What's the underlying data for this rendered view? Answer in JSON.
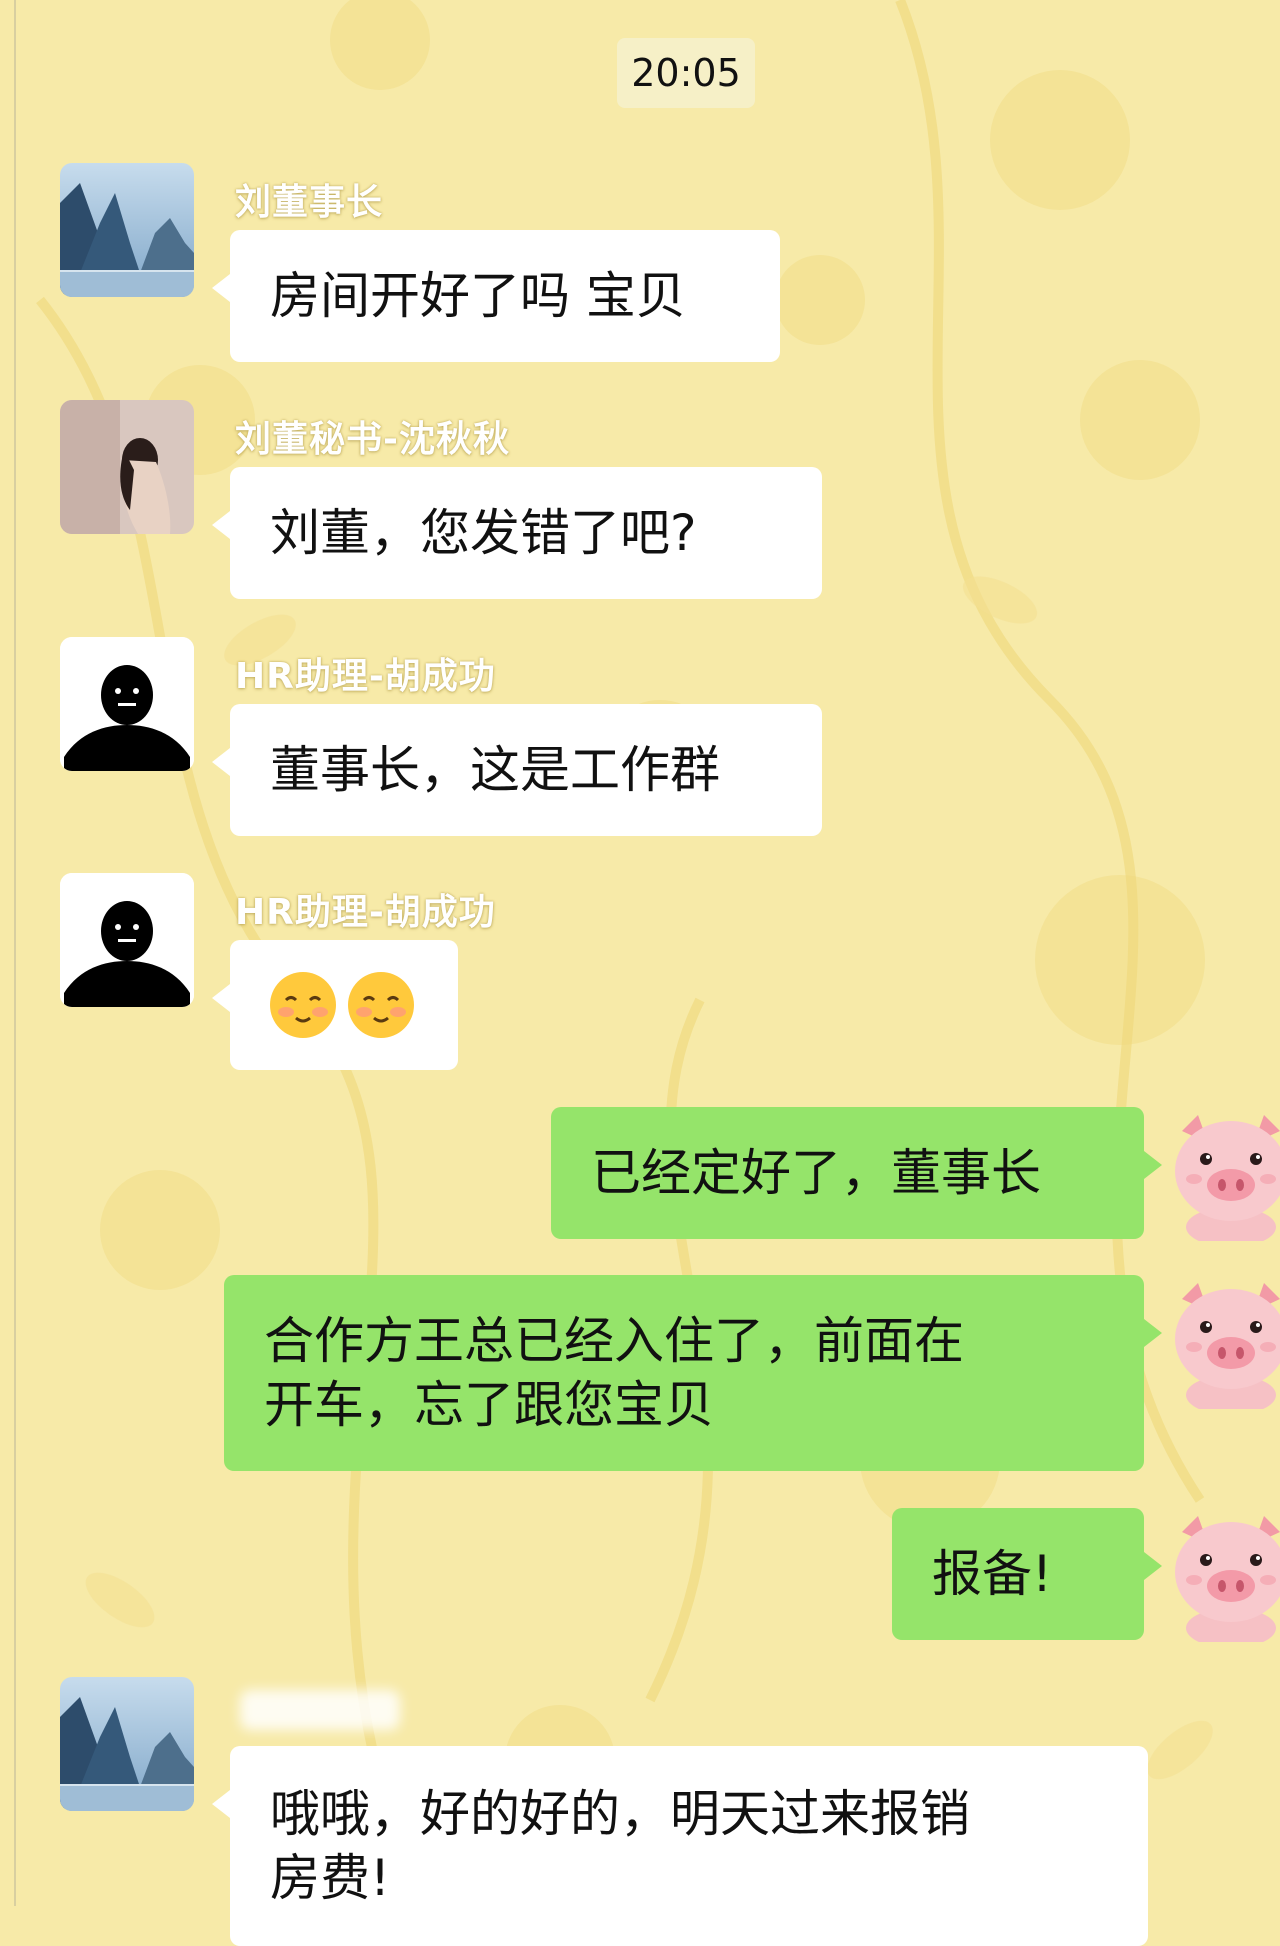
{
  "header": {
    "time": "20:05"
  },
  "messages": [
    {
      "sender": "刘董事长",
      "text": "房间开好了吗 宝贝",
      "direction": "in",
      "avatar": "landscape-avatar"
    },
    {
      "sender": "刘董秘书-沈秋秋",
      "text": "刘董，您发错了吧?",
      "direction": "in",
      "avatar": "woman-photo-avatar"
    },
    {
      "sender": "HR助理-胡成功",
      "text": "董事长，这是工作群",
      "direction": "in",
      "avatar": "silhouette-avatar"
    },
    {
      "sender": "HR助理-胡成功",
      "emoji": [
        "blushing-smile-emoji",
        "blushing-smile-emoji"
      ],
      "direction": "in",
      "avatar": "silhouette-avatar"
    },
    {
      "text": "已经定好了，董事长",
      "direction": "out",
      "avatar": "pig-avatar"
    },
    {
      "text": "合作方王总已经入住了，前面在\n开车，忘了跟您宝贝",
      "direction": "out",
      "avatar": "pig-avatar"
    },
    {
      "text": "报备!",
      "direction": "out",
      "avatar": "pig-avatar"
    },
    {
      "sender": "",
      "sender_blurred": true,
      "text": "哦哦，好的好的，明天过来报销\n房费!",
      "direction": "in",
      "avatar": "landscape-avatar"
    }
  ],
  "colors": {
    "background": "#f7eaa8",
    "incoming_bubble": "#ffffff",
    "outgoing_bubble": "#95e46a"
  }
}
